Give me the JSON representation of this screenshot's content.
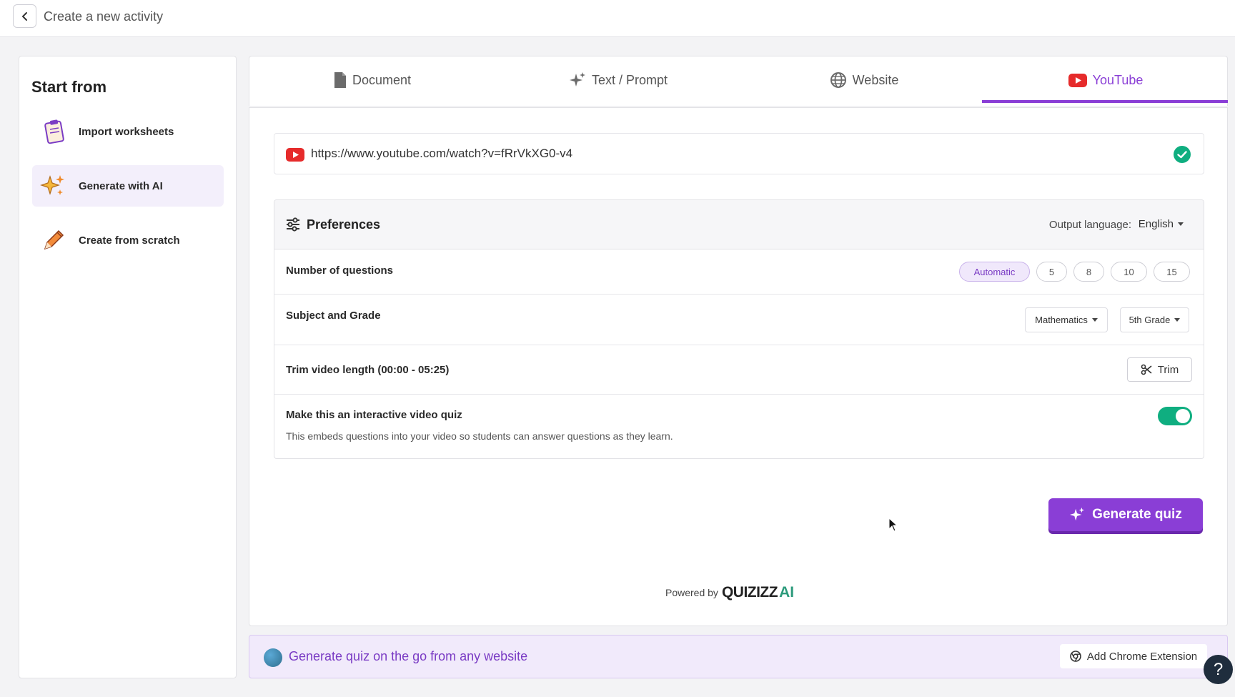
{
  "header": {
    "title": "Create a new activity"
  },
  "sidebar": {
    "heading": "Start from",
    "items": [
      {
        "label": "Import worksheets",
        "icon": "clipboard-icon",
        "active": false
      },
      {
        "label": "Generate with AI",
        "icon": "sparkle-stars-icon",
        "active": true
      },
      {
        "label": "Create from scratch",
        "icon": "pencil-icon",
        "active": false
      }
    ]
  },
  "tabs": [
    {
      "label": "Document",
      "icon": "document-icon"
    },
    {
      "label": "Text / Prompt",
      "icon": "sparkle-icon"
    },
    {
      "label": "Website",
      "icon": "globe-icon"
    },
    {
      "label": "YouTube",
      "icon": "youtube-icon",
      "active": true
    }
  ],
  "url_input": {
    "value": "https://www.youtube.com/watch?v=fRrVkXG0-v4"
  },
  "preferences": {
    "title": "Preferences",
    "output_language_label": "Output language:",
    "output_language_value": "English",
    "num_questions": {
      "label": "Number of questions",
      "options": [
        "Automatic",
        "5",
        "8",
        "10",
        "15"
      ],
      "selected": "Automatic"
    },
    "subject_grade": {
      "label": "Subject and Grade",
      "subject": "Mathematics",
      "grade": "5th Grade"
    },
    "trim": {
      "label": "Trim video length (00:00 - 05:25)",
      "button": "Trim"
    },
    "interactive": {
      "label": "Make this an interactive video quiz",
      "description": "This embeds questions into your video so students can answer questions as they learn.",
      "enabled": true
    }
  },
  "generate_button": "Generate quiz",
  "powered_by": {
    "prefix": "Powered by",
    "brand": "QUIZIZZ",
    "suffix": "AI"
  },
  "extension_bar": {
    "text": "Generate quiz on the go from any website",
    "button": "Add Chrome Extension"
  },
  "help": "?",
  "colors": {
    "accent": "#8a3ed6",
    "toggle_on": "#0fae80",
    "youtube": "#e62b2b"
  }
}
